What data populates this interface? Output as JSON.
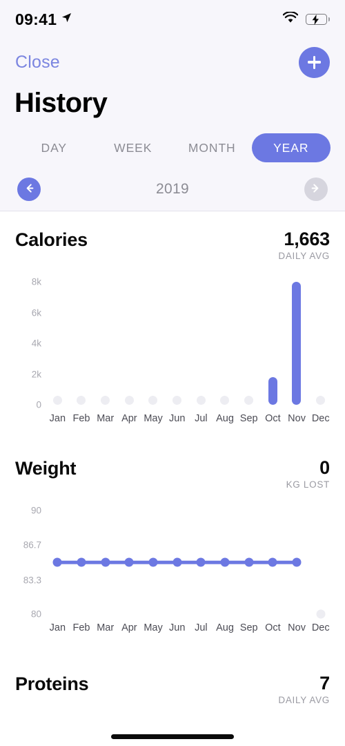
{
  "status_bar": {
    "time": "09:41",
    "location_icon": "location-arrow-icon",
    "wifi_icon": "wifi-icon",
    "battery_icon": "battery-charging-icon"
  },
  "nav": {
    "close_label": "Close",
    "add_icon": "plus-icon"
  },
  "header": {
    "title": "History"
  },
  "segments": {
    "items": [
      {
        "label": "DAY",
        "active": false
      },
      {
        "label": "WEEK",
        "active": false
      },
      {
        "label": "MONTH",
        "active": false
      },
      {
        "label": "YEAR",
        "active": true
      }
    ]
  },
  "period_nav": {
    "prev_icon": "arrow-left-icon",
    "next_icon": "arrow-right-icon",
    "label": "2019",
    "prev_enabled": true,
    "next_enabled": false
  },
  "colors": {
    "accent": "#6C78E2",
    "accent_text": "#7B85E0",
    "muted": "#8C8C94",
    "empty_dot": "#EDEDF2",
    "disabled": "#D6D5DE",
    "header_bg": "#F7F6FB",
    "battery_green": "#3DDC65"
  },
  "cards": [
    {
      "title": "Calories",
      "stat_value": "1,663",
      "stat_unit": "DAILY AVG"
    },
    {
      "title": "Weight",
      "stat_value": "0",
      "stat_unit": "KG LOST"
    },
    {
      "title": "Proteins",
      "stat_value": "7",
      "stat_unit": "DAILY AVG"
    }
  ],
  "chart_data": [
    {
      "type": "bar",
      "title": "Calories",
      "xlabel": "",
      "ylabel": "",
      "categories": [
        "Jan",
        "Feb",
        "Mar",
        "Apr",
        "May",
        "Jun",
        "Jul",
        "Aug",
        "Sep",
        "Oct",
        "Nov",
        "Dec"
      ],
      "values": [
        0,
        0,
        0,
        0,
        0,
        0,
        0,
        0,
        0,
        1800,
        8000,
        0
      ],
      "ytick_labels": [
        "8k",
        "6k",
        "4k",
        "2k",
        "0"
      ],
      "ytick_values": [
        8000,
        6000,
        4000,
        2000,
        0
      ],
      "ylim": [
        0,
        8000
      ],
      "grid": false,
      "legend": "none",
      "summary_value": "1,663",
      "summary_unit": "DAILY AVG"
    },
    {
      "type": "line",
      "title": "Weight",
      "xlabel": "",
      "ylabel": "",
      "categories": [
        "Jan",
        "Feb",
        "Mar",
        "Apr",
        "May",
        "Jun",
        "Jul",
        "Aug",
        "Sep",
        "Oct",
        "Nov",
        "Dec"
      ],
      "values": [
        85,
        85,
        85,
        85,
        85,
        85,
        85,
        85,
        85,
        85,
        85,
        null
      ],
      "ytick_labels": [
        "90",
        "86.7",
        "83.3",
        "80"
      ],
      "ytick_values": [
        90,
        86.7,
        83.3,
        80
      ],
      "ylim": [
        80,
        90
      ],
      "grid": false,
      "legend": "none",
      "summary_value": "0",
      "summary_unit": "KG LOST"
    }
  ]
}
